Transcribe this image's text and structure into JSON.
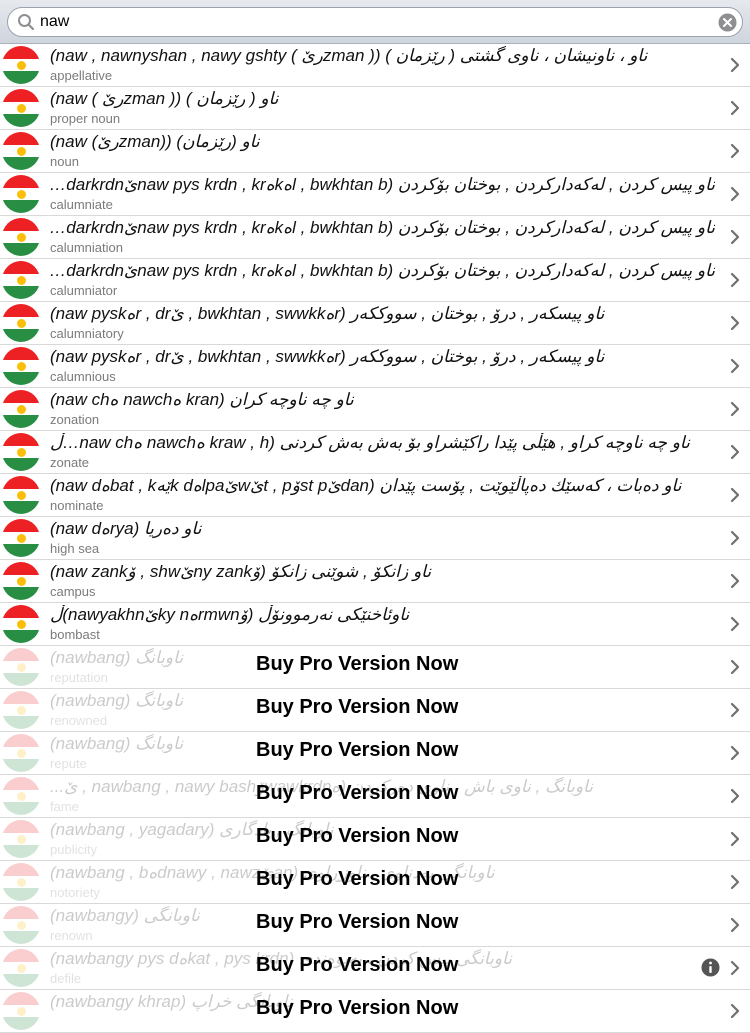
{
  "search": {
    "value": "naw"
  },
  "colors": {
    "flag_red": "#ed2024",
    "flag_white": "#ffffff",
    "flag_green": "#278e43",
    "flag_sun": "#fcbf09"
  },
  "rows": [
    {
      "title": "ناو ، ناونیشان ، ناوی گشتی ( رێزمان ) (( zmanرێ ) naw , nawnyshan , nawy gshty)",
      "subtitle": "appellative"
    },
    {
      "title": "ناو ( رێزمان ) (( zmanرێ ) naw)",
      "subtitle": "proper noun"
    },
    {
      "title": "ناو (رێزمان) ((zmanرێ) naw)",
      "subtitle": "noun"
    },
    {
      "title": "ناو پیس کردن , لەکەدارکردن , بوختان بۆکردن (l , bwkhtan bەkەnaw pys krdn , krێdarkrdn…",
      "subtitle": "calumniate"
    },
    {
      "title": "ناو پیس کردن , لەکەدارکردن , بوختان بۆکردن (l , bwkhtan bەkەnaw pys krdn , krێdarkrdn…",
      "subtitle": "calumniation"
    },
    {
      "title": "ناو پیس کردن , لەکەدارکردن , بوختان بۆکردن (l , bwkhtan bەkەnaw pys krdn , krێdarkrdn…",
      "subtitle": "calumniator"
    },
    {
      "title": "ناو پیسکەر , درۆ , بوختان , سووککەر (rەbwkhtan , swwkk , ێr , drەnaw pysk)",
      "subtitle": "calumniatory"
    },
    {
      "title": "ناو پیسکەر , درۆ , بوختان , سووککەر (rەbwkhtan , swwkk , ێr , drەnaw pysk)",
      "subtitle": "calumnious"
    },
    {
      "title": "ناو چە ناوچە کران (kran ەnawch ەnaw ch)",
      "subtitle": "zonation"
    },
    {
      "title": "ناو چە ناوچە کراو , هێڵی پێدا راکێشراو بۆ بەش بەش کردنی (kraw , h ەnawch ەnaw ch…ڵ",
      "subtitle": "zonate"
    },
    {
      "title": "ناو دەبات ، کەسێك دەپاڵێوێت , پۆست پێدان (danێst pۆt , pێwێlpaەk dێەbat , kەnaw d)",
      "subtitle": "nominate"
    },
    {
      "title": "ناو دەریا (ryaەnaw d)",
      "subtitle": "high sea"
    },
    {
      "title": "ناو زانکۆ , شوێنی زانکۆ (ۆny zankێshw , ۆnaw zank)",
      "subtitle": "campus"
    },
    {
      "title": "ناوئاخنێکی نەرموونۆڵ (ۆrmwnەky nێnawyakhn)ڵ",
      "subtitle": "bombast"
    },
    {
      "title": "ناوبانگ (nawbang)",
      "subtitle": "reputation"
    },
    {
      "title": "ناوبانگ (nawbang)",
      "subtitle": "renowned"
    },
    {
      "title": "ناوبانگ (nawbang)",
      "subtitle": "repute"
    },
    {
      "title": "ناوبانگ , ناوی باش ، ناوی دەرکردن (ەwawkrdnۆnawbang , nawy bash , ێ...",
      "subtitle": "fame"
    },
    {
      "title": "ناوبانگ , یادگاری (nawbang , yagadary)",
      "subtitle": "publicity"
    },
    {
      "title": "ناوبانگی بەدناوی ، ناوزڕاوی (anێdnawy , nawzەnawbang , b)",
      "subtitle": "notoriety"
    },
    {
      "title": "ناوبانگی (nawbangy)",
      "subtitle": "renown"
    },
    {
      "title": "ناوبانگی پیس کردن ، پەیوەندی (kat , pys krdnەnawbangy pys d)",
      "subtitle": "defile"
    },
    {
      "title": "ناوبانگی خراپ (nawbangy khrap)",
      "subtitle": ""
    }
  ],
  "promo": {
    "label": "Buy Pro Version Now"
  },
  "icons": {
    "search": "search-icon",
    "clear": "clear-icon",
    "chevron": "chevron-right-icon",
    "flag": "kurdistan-flag-icon",
    "info": "info-icon"
  }
}
